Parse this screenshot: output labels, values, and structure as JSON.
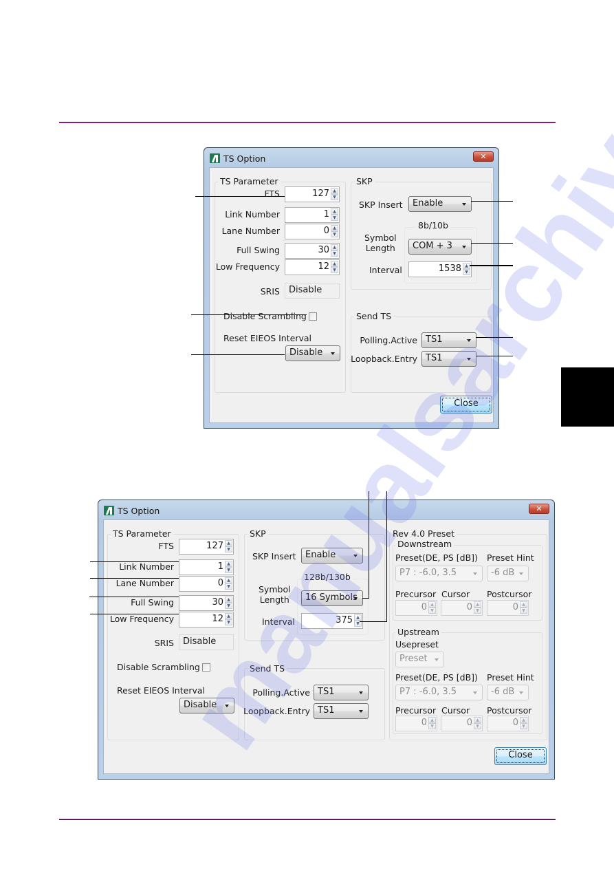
{
  "page": {
    "header_rule_color": "#8a1c7c",
    "footer_rule_color": "#5a1c5c",
    "side_tab_color": "#000000",
    "watermark_text": "manualsarchive.com"
  },
  "dialog_gen3": {
    "title": "TS Option",
    "ts_parameter": {
      "title": "TS Parameter",
      "fts_label": "FTS",
      "fts_value": "127",
      "link_number_label": "Link Number",
      "link_number_value": "1",
      "lane_number_label": "Lane Number",
      "lane_number_value": "0",
      "full_swing_label": "Full Swing",
      "full_swing_value": "30",
      "low_frequency_label": "Low Frequency",
      "low_frequency_value": "12",
      "sris_label": "SRIS",
      "sris_value": "Disable",
      "disable_scrambling_label": "Disable Scrambling",
      "disable_scrambling_checked": false,
      "reset_eieos_label": "Reset EIEOS Interval",
      "reset_eieos_value": "Disable"
    },
    "skp": {
      "title": "SKP",
      "skp_insert_label": "SKP Insert",
      "skp_insert_value": "Enable",
      "encoding_label": "8b/10b",
      "symbol_length_label_1": "Symbol",
      "symbol_length_label_2": "Length",
      "symbol_length_value": "COM + 3",
      "interval_label": "Interval",
      "interval_value": "1538"
    },
    "send_ts": {
      "title": "Send TS",
      "polling_active_label": "Polling.Active",
      "polling_active_value": "TS1",
      "loopback_entry_label": "Loopback.Entry",
      "loopback_entry_value": "TS1"
    },
    "close_label": "Close"
  },
  "dialog_gen4": {
    "title": "TS Option",
    "ts_parameter": {
      "title": "TS Parameter",
      "fts_label": "FTS",
      "fts_value": "127",
      "link_number_label": "Link Number",
      "link_number_value": "1",
      "lane_number_label": "Lane Number",
      "lane_number_value": "0",
      "full_swing_label": "Full Swing",
      "full_swing_value": "30",
      "low_frequency_label": "Low Frequency",
      "low_frequency_value": "12",
      "sris_label": "SRIS",
      "sris_value": "Disable",
      "disable_scrambling_label": "Disable Scrambling",
      "disable_scrambling_checked": false,
      "reset_eieos_label": "Reset EIEOS Interval",
      "reset_eieos_value": "Disable"
    },
    "skp": {
      "title": "SKP",
      "skp_insert_label": "SKP Insert",
      "skp_insert_value": "Enable",
      "encoding_label": "128b/130b",
      "symbol_length_label_1": "Symbol",
      "symbol_length_label_2": "Length",
      "symbol_length_value": "16 Symbols",
      "interval_label": "Interval",
      "interval_value": "375"
    },
    "send_ts": {
      "title": "Send TS",
      "polling_active_label": "Polling.Active",
      "polling_active_value": "TS1",
      "loopback_entry_label": "Loopback.Entry",
      "loopback_entry_value": "TS1"
    },
    "rev40_preset": {
      "title": "Rev 4.0 Preset",
      "downstream": {
        "title": "Downstream",
        "preset_label": "Preset(DE, PS [dB])",
        "preset_value": "P7 : -6.0, 3.5",
        "preset_hint_label": "Preset Hint",
        "preset_hint_value": "-6 dB",
        "precursor_label": "Precursor",
        "precursor_value": "0",
        "cursor_label": "Cursor",
        "cursor_value": "0",
        "postcursor_label": "Postcursor",
        "postcursor_value": "0"
      },
      "upstream": {
        "title": "Upstream",
        "usepreset_label": "Usepreset",
        "usepreset_value": "Preset",
        "preset_label": "Preset(DE, PS [dB])",
        "preset_value": "P7 : -6.0, 3.5",
        "preset_hint_label": "Preset Hint",
        "preset_hint_value": "-6 dB",
        "precursor_label": "Precursor",
        "precursor_value": "0",
        "cursor_label": "Cursor",
        "cursor_value": "0",
        "postcursor_label": "Postcursor",
        "postcursor_value": "0"
      }
    },
    "close_label": "Close"
  }
}
